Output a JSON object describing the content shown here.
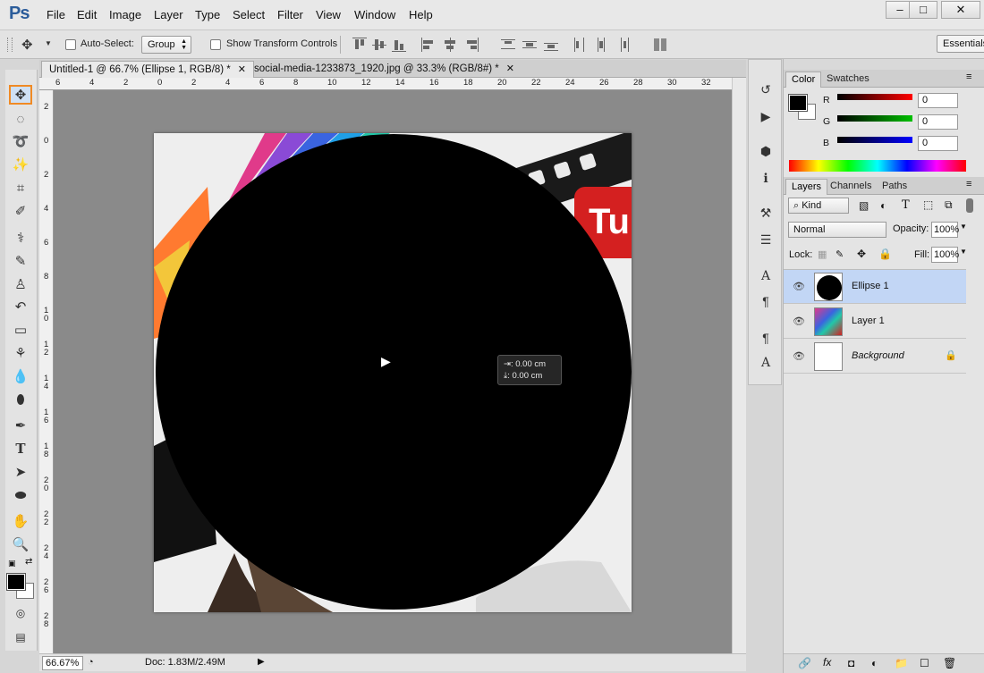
{
  "app": {
    "logo": "Ps"
  },
  "menu": [
    "File",
    "Edit",
    "Image",
    "Layer",
    "Type",
    "Select",
    "Filter",
    "View",
    "Window",
    "Help"
  ],
  "window_controls": {
    "minimize": "‒",
    "maximize": "□",
    "close": "✕"
  },
  "options_bar": {
    "auto_select_label": "Auto-Select:",
    "auto_select_target": "Group",
    "show_transform_label": "Show Transform Controls",
    "workspace": "Essentials"
  },
  "tabs": [
    {
      "title": "Untitled-1 @ 66.7% (Ellipse 1, RGB/8) *",
      "active": true
    },
    {
      "title": "social-media-1233873_1920.jpg @ 33.3% (RGB/8#) *",
      "active": false
    }
  ],
  "rulers": {
    "h_ticks": [
      "6",
      "4",
      "2",
      "0",
      "2",
      "4",
      "6",
      "8",
      "10",
      "12",
      "14",
      "16",
      "18",
      "20",
      "22",
      "24",
      "26",
      "28",
      "30",
      "32"
    ],
    "v_ticks": [
      "2",
      "0",
      "2",
      "4",
      "6",
      "8",
      "10",
      "12",
      "14",
      "16",
      "18",
      "20",
      "22",
      "24",
      "26",
      "28"
    ]
  },
  "canvas": {
    "tooltip_dx": "0.00 cm",
    "tooltip_dy": "0.00 cm"
  },
  "status": {
    "zoom": "66.67%",
    "doc": "Doc: 1.83M/2.49M"
  },
  "tools": [
    "move-tool",
    "marquee-tool",
    "lasso-tool",
    "quick-select-tool",
    "crop-tool",
    "eyedropper-tool",
    "healing-tool",
    "brush-tool",
    "stamp-tool",
    "history-brush-tool",
    "eraser-tool",
    "paint-bucket-tool",
    "blur-tool",
    "dodge-tool",
    "pen-tool",
    "type-tool",
    "path-select-tool",
    "ellipse-tool",
    "hand-tool",
    "zoom-tool"
  ],
  "color_panel": {
    "tabs": [
      "Color",
      "Swatches"
    ],
    "channels": [
      {
        "label": "R",
        "value": "0",
        "color": "#ff0000"
      },
      {
        "label": "G",
        "value": "0",
        "color": "#00c000"
      },
      {
        "label": "B",
        "value": "0",
        "color": "#0000ff"
      }
    ]
  },
  "layers_panel": {
    "tabs": [
      "Layers",
      "Channels",
      "Paths"
    ],
    "filter": "Kind",
    "blend_mode": "Normal",
    "opacity_label": "Opacity:",
    "opacity": "100%",
    "lock_label": "Lock:",
    "fill_label": "Fill:",
    "fill": "100%",
    "layers": [
      {
        "name": "Ellipse 1",
        "selected": true
      },
      {
        "name": "Layer 1",
        "selected": false
      },
      {
        "name": "Background",
        "selected": false
      }
    ]
  },
  "colors": {
    "accent": "#f08a24",
    "selection": "#c2d6f5"
  }
}
